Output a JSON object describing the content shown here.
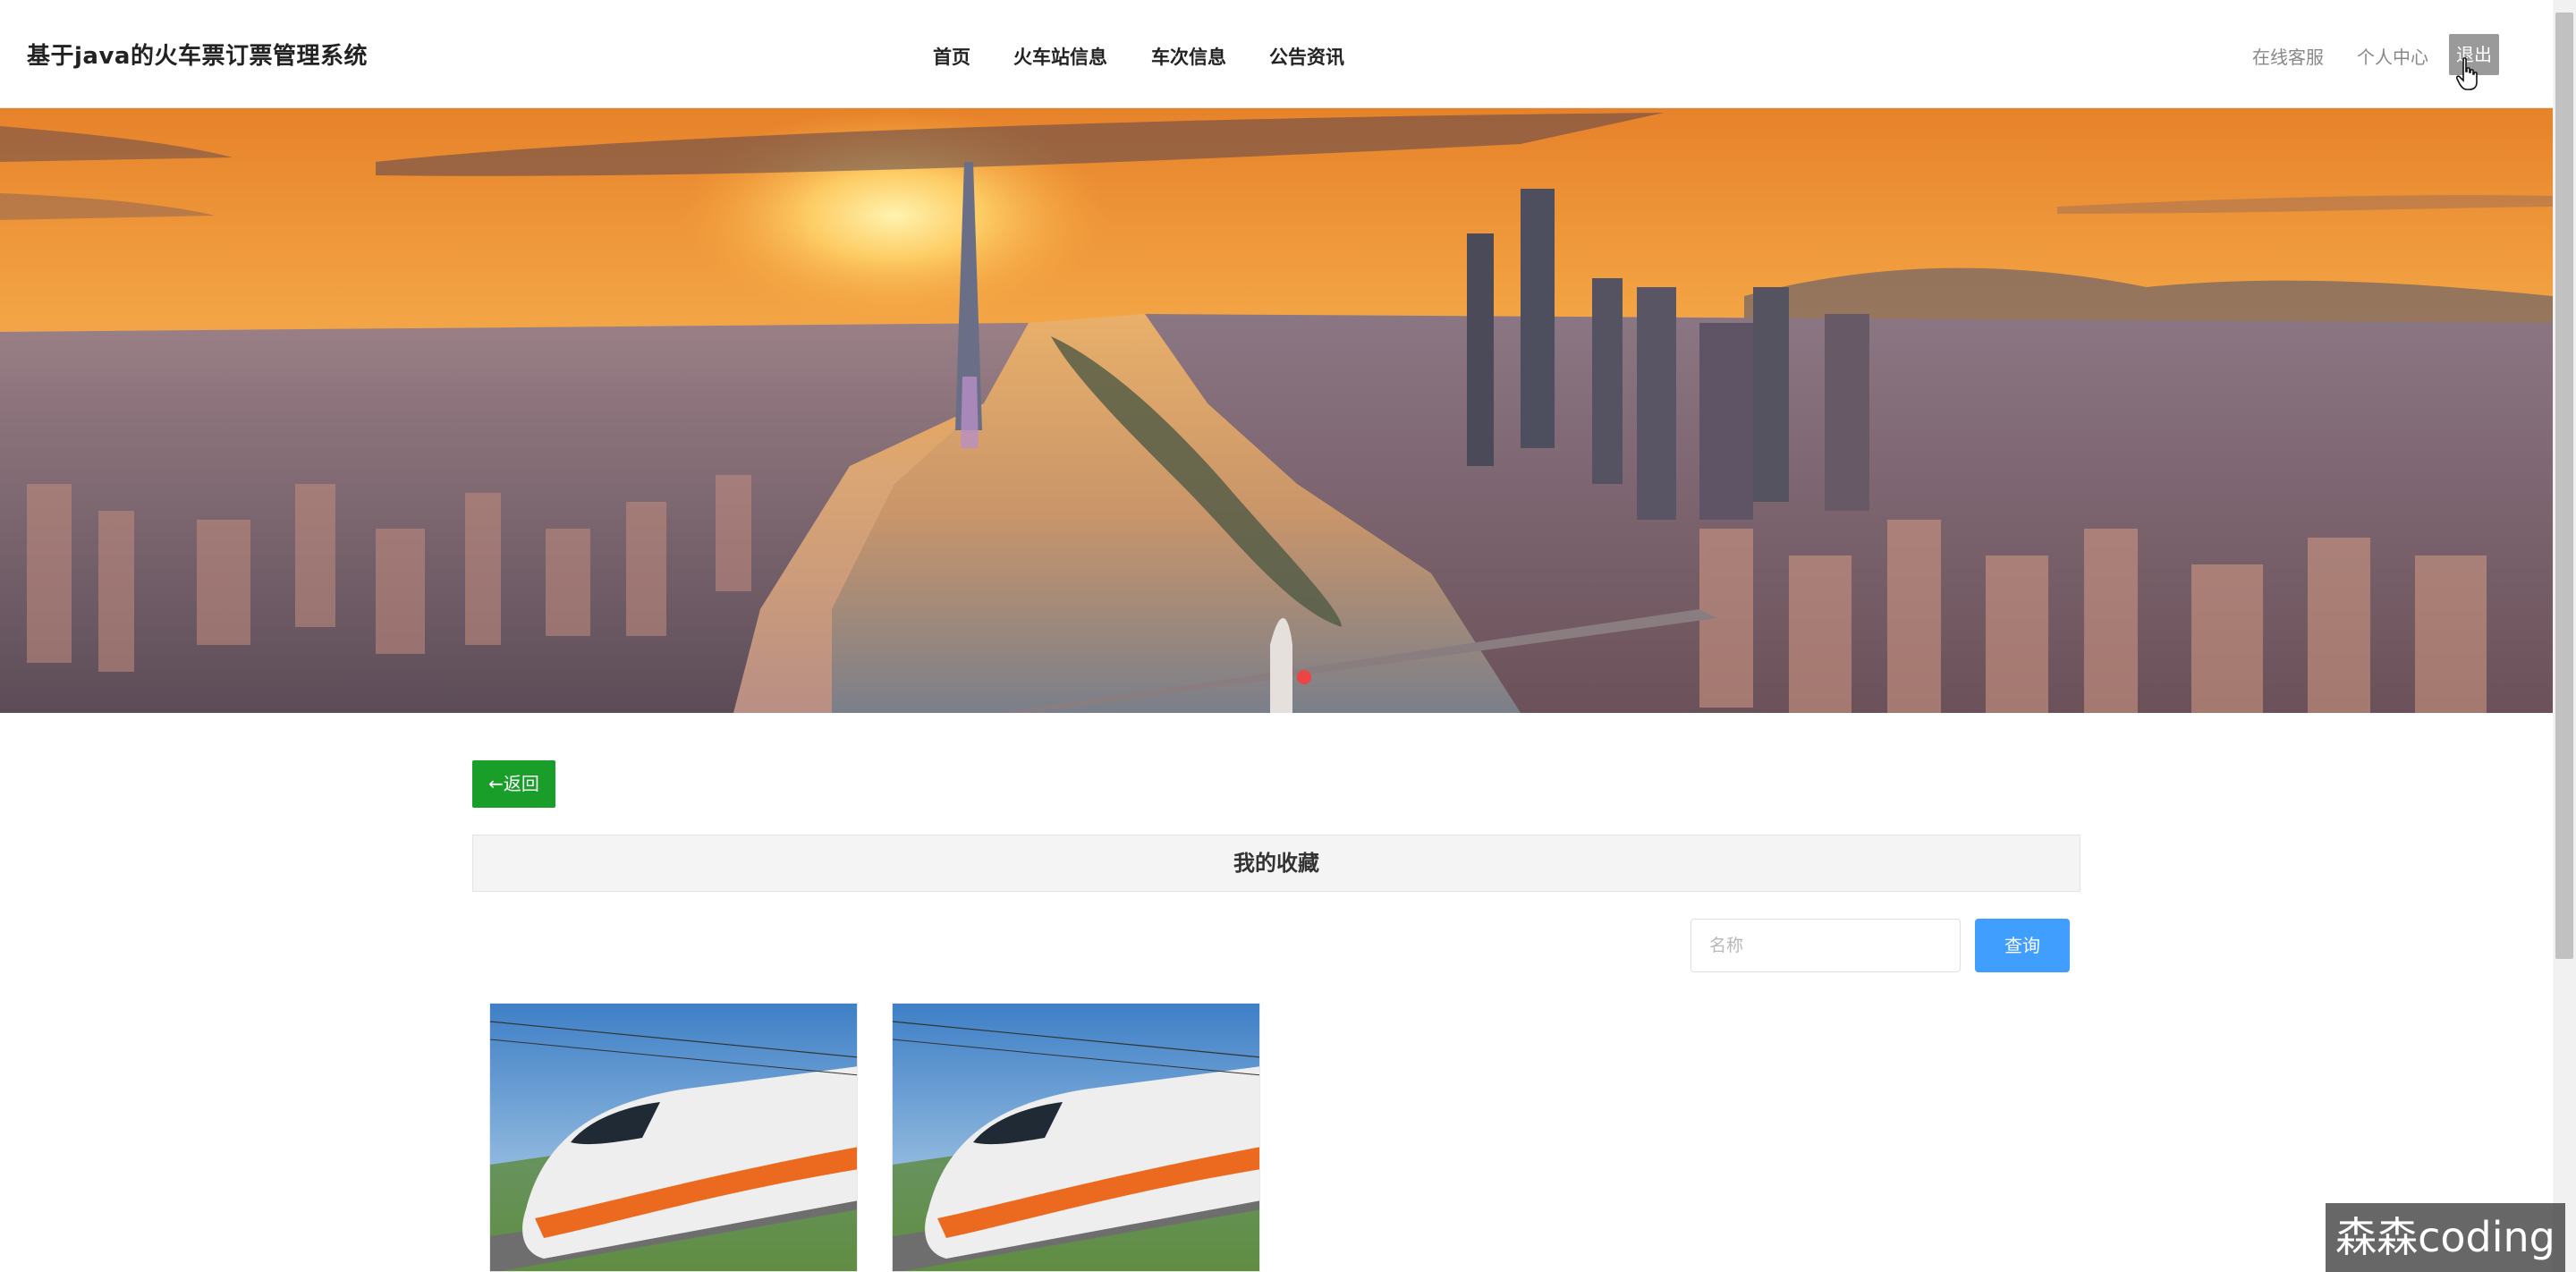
{
  "header": {
    "brand": "基于java的火车票订票管理系统",
    "nav": [
      {
        "label": "首页"
      },
      {
        "label": "火车站信息"
      },
      {
        "label": "车次信息"
      },
      {
        "label": "公告资讯"
      }
    ],
    "online_service": "在线客服",
    "personal_center": "个人中心",
    "logout": "退出"
  },
  "banner": {
    "image": "city-sunset-river-skyline"
  },
  "content": {
    "back_label": "←返回",
    "section_title": "我的收藏",
    "search": {
      "placeholder": "名称",
      "value": ""
    },
    "search_button": "查询",
    "favorites": [
      {
        "image": "high-speed-train-photo"
      },
      {
        "image": "high-speed-train-photo"
      }
    ]
  },
  "overlay": {
    "watermark": "森森coding"
  },
  "colors": {
    "back_button": "#1a9e2a",
    "search_button": "#409eff",
    "logout_button": "#9a9a9a"
  }
}
